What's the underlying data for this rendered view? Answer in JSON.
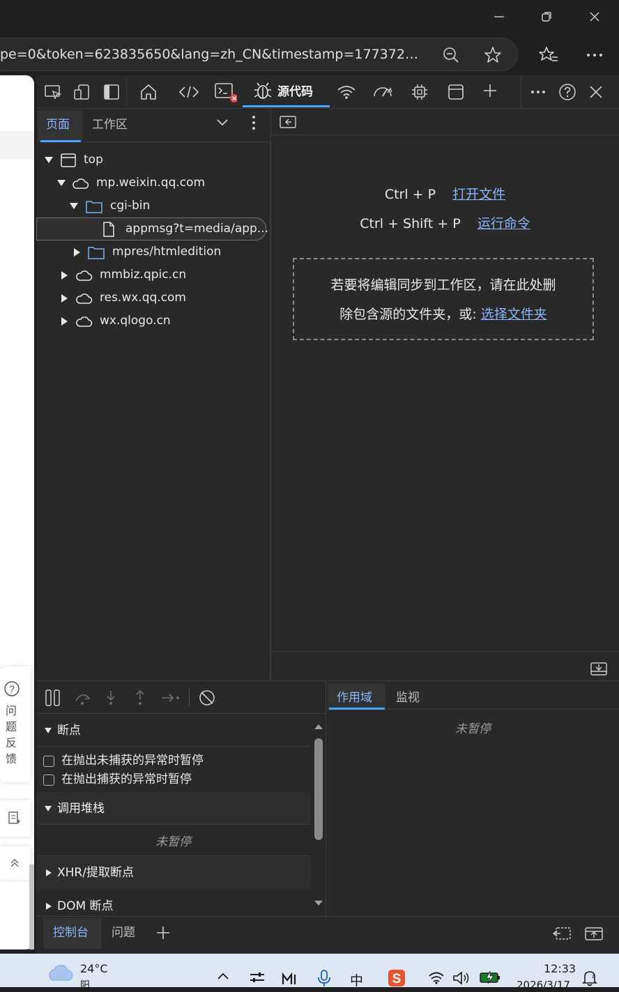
{
  "browser": {
    "address": "pe=0&token=623835650&lang=zh_CN&timestamp=17737218..."
  },
  "page": {
    "feedback_label": [
      "问",
      "题",
      "反",
      "馈"
    ]
  },
  "devtools": {
    "toolbar": {
      "active_tab": "源代码"
    },
    "navigator": {
      "tabs": [
        "页面",
        "工作区"
      ],
      "tree": [
        {
          "label": "top",
          "level": 0,
          "kind": "frame",
          "expanded": true
        },
        {
          "label": "mp.weixin.qq.com",
          "level": 1,
          "kind": "cloud",
          "expanded": true
        },
        {
          "label": "cgi-bin",
          "level": 2,
          "kind": "folder",
          "expanded": true
        },
        {
          "label": "appmsg?t=media/app...",
          "level": 3,
          "kind": "file",
          "selected": true
        },
        {
          "label": "mpres/htmledition",
          "level": 2,
          "kind": "folder",
          "expanded": false
        },
        {
          "label": "mmbiz.qpic.cn",
          "level": 1,
          "kind": "cloud",
          "expanded": false
        },
        {
          "label": "res.wx.qq.com",
          "level": 1,
          "kind": "cloud",
          "expanded": false
        },
        {
          "label": "wx.qlogo.cn",
          "level": 1,
          "kind": "cloud",
          "expanded": false
        }
      ]
    },
    "editor": {
      "shortcut1_keys": "Ctrl + P",
      "shortcut1_action": "打开文件",
      "shortcut2_keys": "Ctrl + Shift + P",
      "shortcut2_action": "运行命令",
      "drop_line1": "若要将编辑同步到工作区，请在此处删",
      "drop_line2": "除包含源的文件夹，或:",
      "drop_link": "选择文件夹"
    },
    "debugger": {
      "breakpoints_title": "断点",
      "pause_uncaught": "在抛出未捕获的异常时暂停",
      "pause_caught": "在抛出捕获的异常时暂停",
      "callstack_title": "调用堆栈",
      "not_paused": "未暂停",
      "xhr_title": "XHR/提取断点",
      "dom_title": "DOM 断点"
    },
    "scope": {
      "tabs": [
        "作用域",
        "监视"
      ],
      "not_paused": "未暂停"
    },
    "drawer": {
      "tabs": [
        "控制台",
        "问题"
      ]
    }
  },
  "taskbar": {
    "weather_temp": "24°C",
    "weather_desc": "阳",
    "ime": "中",
    "time": "12:33",
    "date": "2026/3/17"
  },
  "colors": {
    "accent": "#4da3ff",
    "link": "#8ab4f8",
    "panel_bg": "#292929"
  }
}
